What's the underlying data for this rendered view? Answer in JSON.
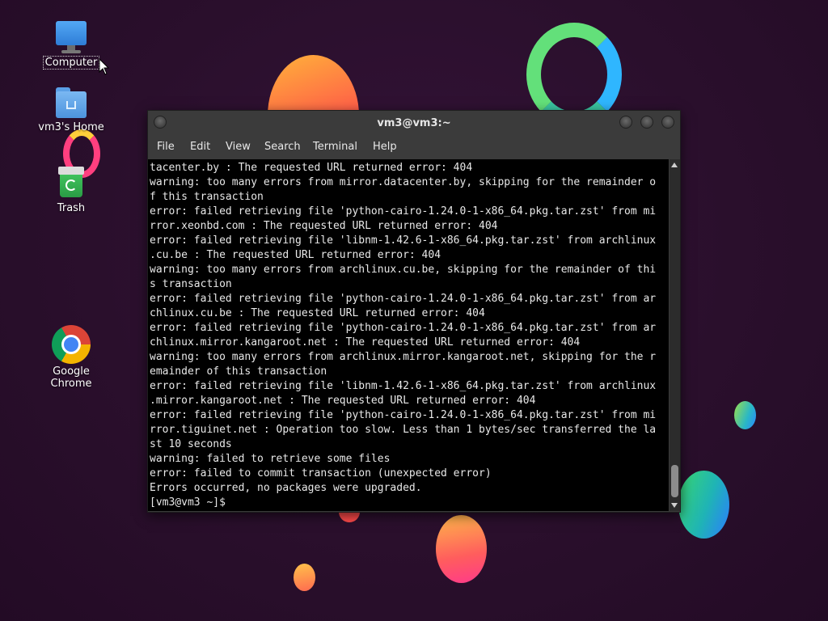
{
  "desktop": {
    "icons": [
      {
        "label": "Computer",
        "icon": "computer-icon"
      },
      {
        "label": "vm3's Home",
        "icon": "home-folder-icon"
      },
      {
        "label": "Trash",
        "icon": "trash-icon"
      },
      {
        "label": "Google Chrome",
        "icon": "chrome-icon"
      }
    ]
  },
  "window": {
    "title": "vm3@vm3:~",
    "menu": [
      "File",
      "Edit",
      "View",
      "Search",
      "Terminal",
      "Help"
    ]
  },
  "terminal": {
    "lines": [
      "tacenter.by : The requested URL returned error: 404",
      "warning: too many errors from mirror.datacenter.by, skipping for the remainder o",
      "f this transaction",
      "error: failed retrieving file 'python-cairo-1.24.0-1-x86_64.pkg.tar.zst' from mi",
      "rror.xeonbd.com : The requested URL returned error: 404",
      "error: failed retrieving file 'libnm-1.42.6-1-x86_64.pkg.tar.zst' from archlinux",
      ".cu.be : The requested URL returned error: 404",
      "warning: too many errors from archlinux.cu.be, skipping for the remainder of thi",
      "s transaction",
      "error: failed retrieving file 'python-cairo-1.24.0-1-x86_64.pkg.tar.zst' from ar",
      "chlinux.cu.be : The requested URL returned error: 404",
      "error: failed retrieving file 'python-cairo-1.24.0-1-x86_64.pkg.tar.zst' from ar",
      "chlinux.mirror.kangaroot.net : The requested URL returned error: 404",
      "warning: too many errors from archlinux.mirror.kangaroot.net, skipping for the r",
      "emainder of this transaction",
      "error: failed retrieving file 'libnm-1.42.6-1-x86_64.pkg.tar.zst' from archlinux",
      ".mirror.kangaroot.net : The requested URL returned error: 404",
      "error: failed retrieving file 'python-cairo-1.24.0-1-x86_64.pkg.tar.zst' from mi",
      "rror.tiguinet.net : Operation too slow. Less than 1 bytes/sec transferred the la",
      "st 10 seconds",
      "warning: failed to retrieve some files",
      "error: failed to commit transaction (unexpected error)",
      "Errors occurred, no packages were upgraded.",
      "[vm3@vm3 ~]$ "
    ]
  }
}
